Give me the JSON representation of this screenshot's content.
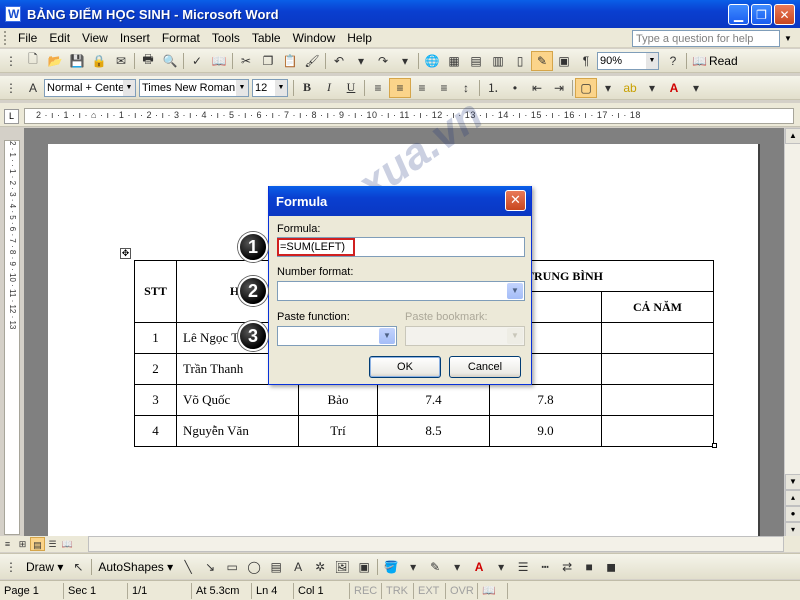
{
  "window": {
    "title": "BẢNG ĐIỂM HỌC SINH - Microsoft Word",
    "min_glyph": "▁",
    "max_glyph": "❐",
    "close_glyph": "✕"
  },
  "menu": {
    "items": [
      "File",
      "Edit",
      "View",
      "Insert",
      "Format",
      "Tools",
      "Table",
      "Window",
      "Help"
    ],
    "ask_placeholder": "Type a question for help"
  },
  "toolbar_standard": {
    "zoom": "90%",
    "read_label": "Read"
  },
  "toolbar_formatting": {
    "style": "Normal + Cente",
    "font": "Times New Roman",
    "size": "12",
    "bold": "B",
    "italic": "I",
    "underline": "U"
  },
  "ruler": {
    "ticks": "2 · ı · 1 · ı · ⌂ · ı · 1 · ı · 2 · ı · 3 · ı · 4 · ı · 5 · ı · 6 · ı · 7 · ı · 8 · ı · 9 · ı · 10 · ı · 11 · ı · 12 · ı · 13 · ı · 14 · ı · 15 · ı · 16 · ı · 17 · ı · 18",
    "vticks": "2 · 1 · · 1 · 2 · 3 · 4 · 5 · 6 · 7 · 8 · 9 · 10 · 11 · 12 · 13"
  },
  "table": {
    "headers": {
      "stt": "STT",
      "ho": "Họ",
      "tb": "ĐIỂM TRUNG BÌNH",
      "canam": "CẢ NĂM"
    },
    "rows": [
      {
        "stt": "1",
        "ho": "Lê Ngọc Tường",
        "ten": "",
        "hk1": "",
        "hk2": ""
      },
      {
        "stt": "2",
        "ho": "Trần Thanh",
        "ten": "",
        "hk1": "",
        "hk2": ""
      },
      {
        "stt": "3",
        "ho": "Võ Quốc",
        "ten": "Bảo",
        "hk1": "7.4",
        "hk2": "7.8"
      },
      {
        "stt": "4",
        "ho": "Nguyễn Văn",
        "ten": "Trí",
        "hk1": "8.5",
        "hk2": "9.0"
      }
    ]
  },
  "dialog": {
    "title": "Formula",
    "formula_label": "Formula:",
    "formula_value": "=SUM(LEFT)",
    "number_format_label": "Number format:",
    "number_format_value": "",
    "paste_function_label": "Paste function:",
    "paste_bookmark_label": "Paste bookmark:",
    "ok_label": "OK",
    "cancel_label": "Cancel"
  },
  "markers": [
    "1",
    "2",
    "3"
  ],
  "watermark": "buaxua.vn",
  "drawbar": {
    "draw_label": "Draw ▾",
    "autoshapes_label": "AutoShapes ▾"
  },
  "status": {
    "page": "Page 1",
    "sec": "Sec 1",
    "pages": "1/1",
    "at": "At 5.3cm",
    "ln": "Ln 4",
    "col": "Col 1",
    "rec": "REC",
    "trk": "TRK",
    "ext": "EXT",
    "ovr": "OVR"
  },
  "colors": {
    "title_bar": "#0a3fd0",
    "highlight_marker": "#d02020",
    "active_button": "#fbd48a"
  }
}
